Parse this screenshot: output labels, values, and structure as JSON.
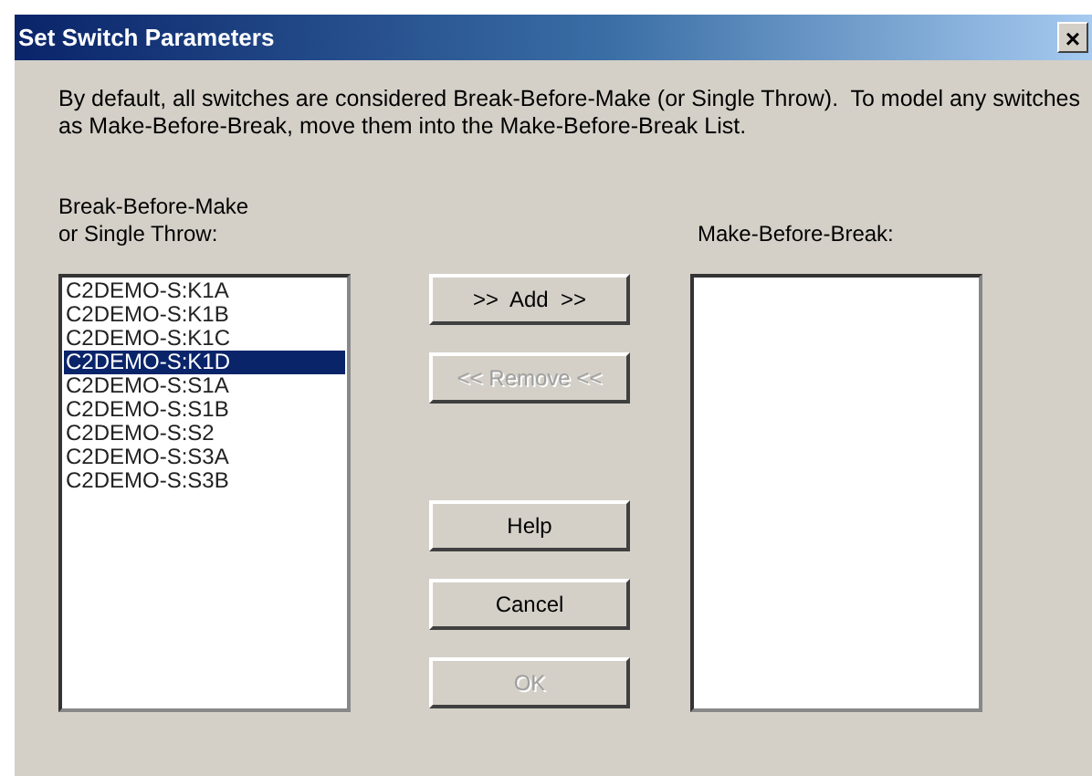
{
  "window": {
    "title": "Set Switch Parameters",
    "close": "×"
  },
  "description": "By default, all switches are considered Break-Before-Make (or Single Throw).  To model any switches as Make-Before-Break, move them into the Make-Before-Break List.",
  "left_list": {
    "label": "Break-Before-Make\nor Single Throw:",
    "items": [
      {
        "text": "C2DEMO-S:K1A",
        "selected": false
      },
      {
        "text": "C2DEMO-S:K1B",
        "selected": false
      },
      {
        "text": "C2DEMO-S:K1C",
        "selected": false
      },
      {
        "text": "C2DEMO-S:K1D",
        "selected": true
      },
      {
        "text": "C2DEMO-S:S1A",
        "selected": false
      },
      {
        "text": "C2DEMO-S:S1B",
        "selected": false
      },
      {
        "text": "C2DEMO-S:S2",
        "selected": false
      },
      {
        "text": "C2DEMO-S:S3A",
        "selected": false
      },
      {
        "text": "C2DEMO-S:S3B",
        "selected": false
      }
    ]
  },
  "right_list": {
    "label": "Make-Before-Break:"
  },
  "move_buttons": [
    {
      "label": ">>  Add  >>",
      "disabled": false
    },
    {
      "label": "<< Remove <<",
      "disabled": true
    }
  ],
  "action_buttons": [
    {
      "label": "Help",
      "disabled": false
    },
    {
      "label": "Cancel",
      "disabled": false
    },
    {
      "label": "OK",
      "disabled": true
    }
  ]
}
